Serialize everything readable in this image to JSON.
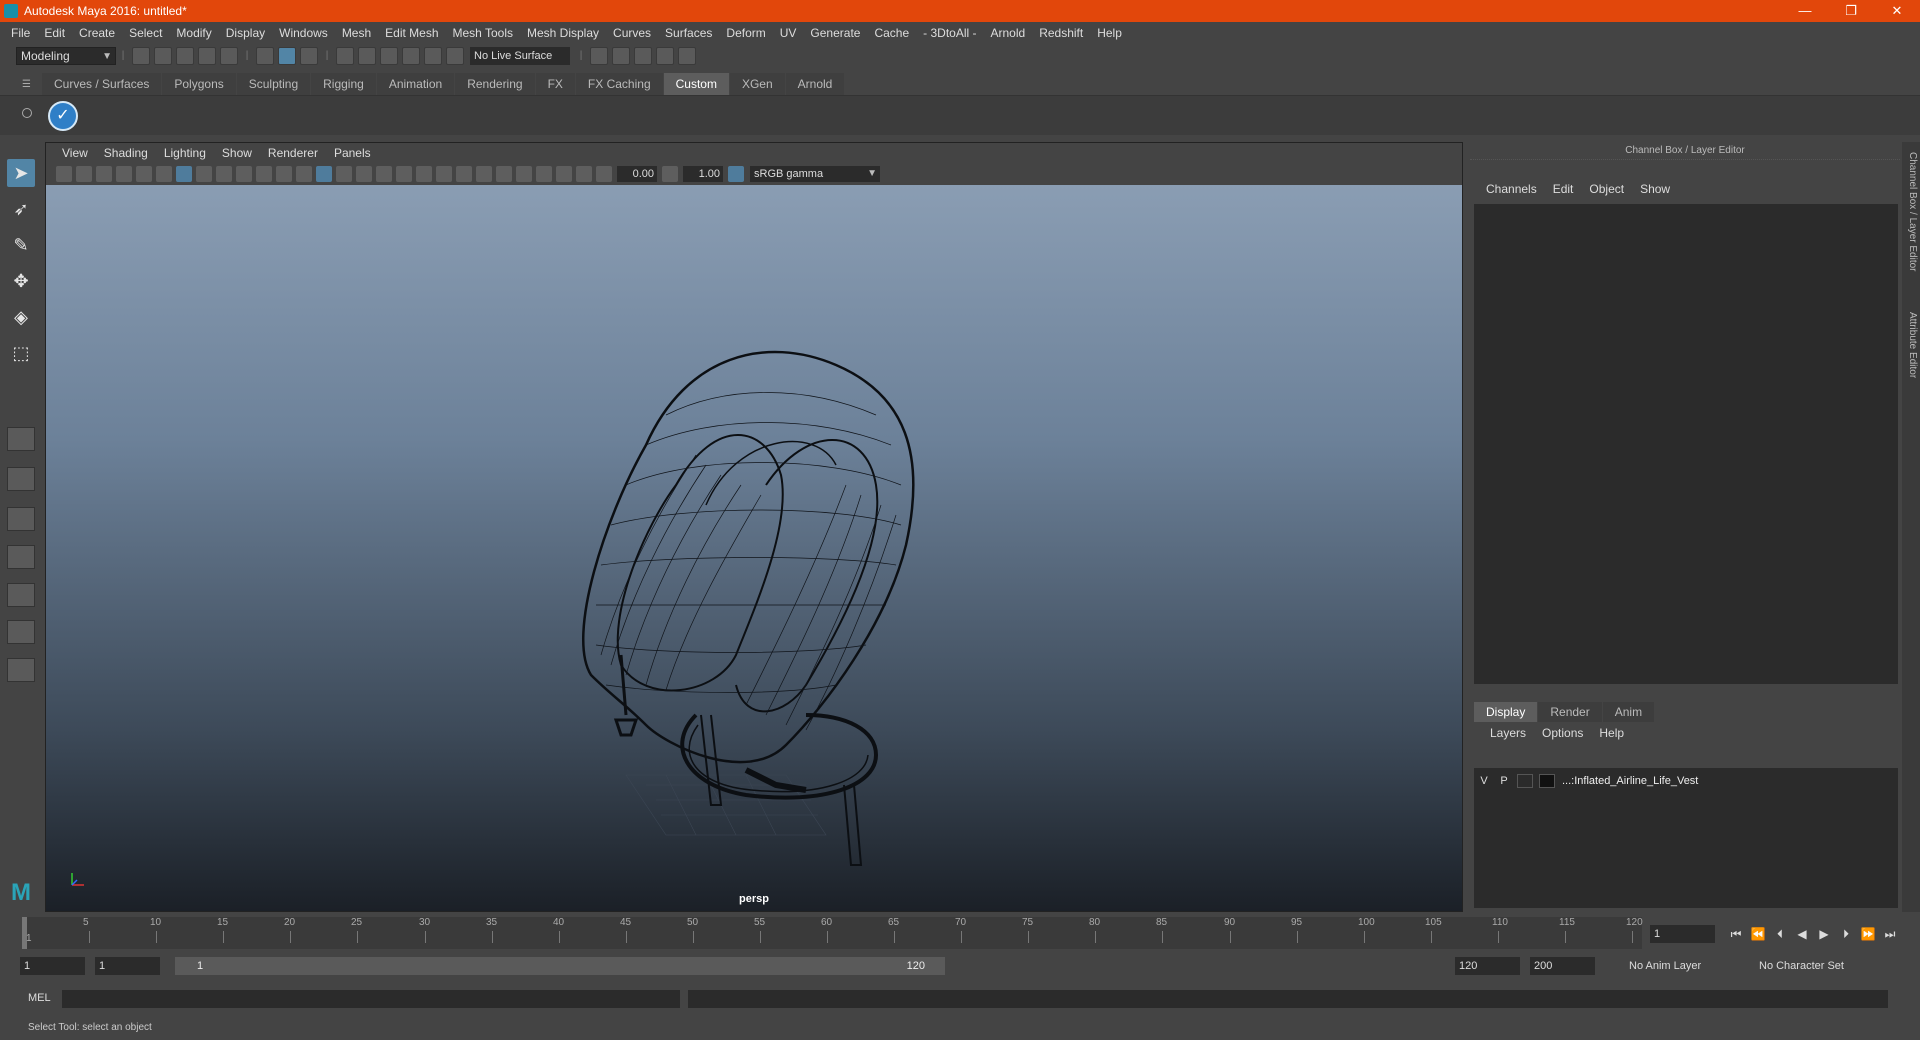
{
  "window": {
    "title": "Autodesk Maya 2016: untitled*",
    "min": "—",
    "max": "❐",
    "close": "✕"
  },
  "menus": [
    "File",
    "Edit",
    "Create",
    "Select",
    "Modify",
    "Display",
    "Windows",
    "Mesh",
    "Edit Mesh",
    "Mesh Tools",
    "Mesh Display",
    "Curves",
    "Surfaces",
    "Deform",
    "UV",
    "Generate",
    "Cache",
    "- 3DtoAll -",
    "Arnold",
    "Redshift",
    "Help"
  ],
  "statusline": {
    "mode": "Modeling",
    "live_surface": "No Live Surface"
  },
  "shelf": {
    "tabs": [
      "Curves / Surfaces",
      "Polygons",
      "Sculpting",
      "Rigging",
      "Animation",
      "Rendering",
      "FX",
      "FX Caching",
      "Custom",
      "XGen",
      "Arnold"
    ],
    "active_tab": "Custom"
  },
  "viewport": {
    "menus": [
      "View",
      "Shading",
      "Lighting",
      "Show",
      "Renderer",
      "Panels"
    ],
    "exposure": "0.00",
    "gamma": "1.00",
    "color_space": "sRGB gamma",
    "camera": "persp"
  },
  "channel_box": {
    "title": "Channel Box / Layer Editor",
    "menus": [
      "Channels",
      "Edit",
      "Object",
      "Show"
    ],
    "layer_tabs": [
      "Display",
      "Render",
      "Anim"
    ],
    "layer_menus": [
      "Layers",
      "Options",
      "Help"
    ],
    "layer": {
      "visible": "V",
      "playback": "P",
      "name": "...:Inflated_Airline_Life_Vest"
    },
    "side_tabs": [
      "Channel Box / Layer Editor",
      "Attribute Editor"
    ]
  },
  "time_slider": {
    "ticks": [
      "5",
      "10",
      "15",
      "20",
      "25",
      "30",
      "35",
      "40",
      "45",
      "50",
      "55",
      "60",
      "65",
      "70",
      "75",
      "80",
      "85",
      "90",
      "95",
      "100",
      "105",
      "110",
      "115",
      "120"
    ],
    "current_frame": "1",
    "frame_field": "1"
  },
  "range_slider": {
    "start": "1",
    "playback_start": "1",
    "bar_start": "1",
    "bar_end": "120",
    "playback_end": "120",
    "end": "200",
    "anim_layer": "No Anim Layer",
    "character_set": "No Character Set"
  },
  "command_line": {
    "language": "MEL"
  },
  "help_line": {
    "message": "Select Tool: select an object"
  }
}
